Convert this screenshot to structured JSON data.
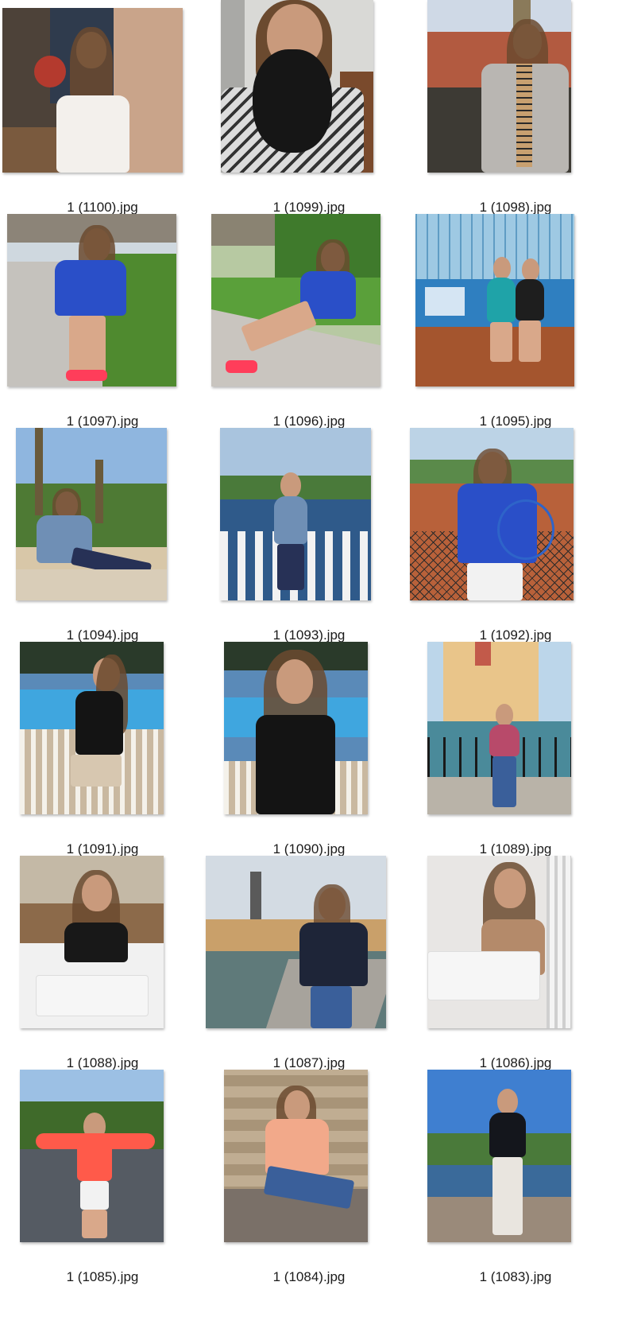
{
  "files": [
    {
      "name": "1 (1100).jpg"
    },
    {
      "name": "1 (1099).jpg"
    },
    {
      "name": "1 (1098).jpg"
    },
    {
      "name": "1 (1097).jpg"
    },
    {
      "name": "1 (1096).jpg"
    },
    {
      "name": "1 (1095).jpg"
    },
    {
      "name": "1 (1094).jpg"
    },
    {
      "name": "1 (1093).jpg"
    },
    {
      "name": "1 (1092).jpg"
    },
    {
      "name": "1 (1091).jpg"
    },
    {
      "name": "1 (1090).jpg"
    },
    {
      "name": "1 (1089).jpg"
    },
    {
      "name": "1 (1088).jpg"
    },
    {
      "name": "1 (1087).jpg"
    },
    {
      "name": "1 (1086).jpg"
    },
    {
      "name": "1 (1085).jpg"
    },
    {
      "name": "1 (1084).jpg"
    },
    {
      "name": "1 (1083).jpg"
    }
  ]
}
